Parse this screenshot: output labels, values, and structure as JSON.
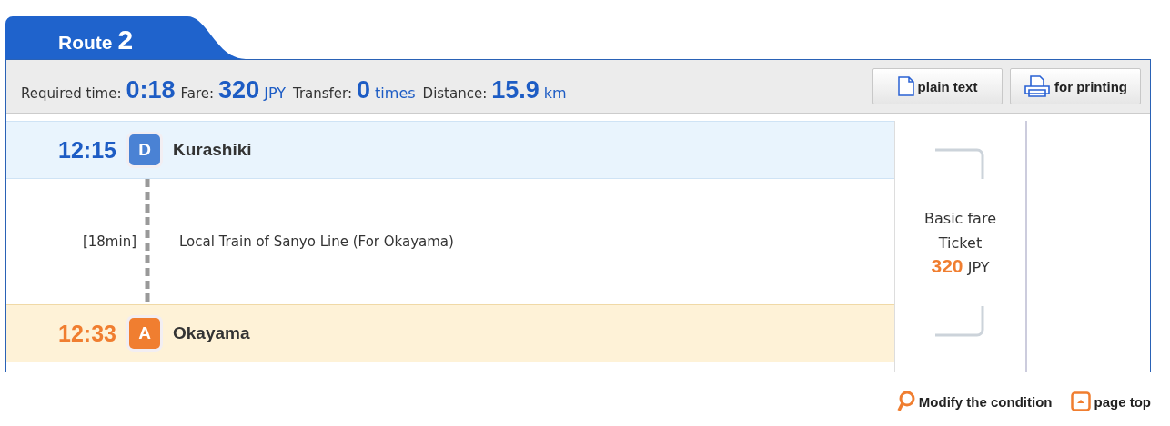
{
  "tab": {
    "label": "Route",
    "number": "2"
  },
  "summary": [
    {
      "label": "Required time:",
      "value": "0:18"
    },
    {
      "label": "Fare:",
      "value": "320",
      "unit": "JPY"
    },
    {
      "label": "Transfer:",
      "value": "0",
      "unit": "times"
    },
    {
      "label": "Distance:",
      "value": "15.9",
      "unit": "km"
    }
  ],
  "buttons": [
    {
      "label": "plain text",
      "kind": "document"
    },
    {
      "label": "for printing",
      "kind": "printer"
    }
  ],
  "stops": [
    {
      "kind": "departure",
      "time": "12:15",
      "badge": "D",
      "name": "Kurashiki"
    },
    {
      "kind": "arrival",
      "time": "12:33",
      "badge": "A",
      "name": "Okayama"
    }
  ],
  "segment": {
    "duration": "[18min]",
    "line": "Local Train of Sanyo Line (For Okayama)"
  },
  "fare": {
    "lines": [
      "Basic fare",
      "Ticket"
    ],
    "amount": "320",
    "unit": "JPY"
  },
  "footer_links": [
    {
      "label": "Modify the condition",
      "kind": "search"
    },
    {
      "label": "page top",
      "kind": "top"
    }
  ]
}
